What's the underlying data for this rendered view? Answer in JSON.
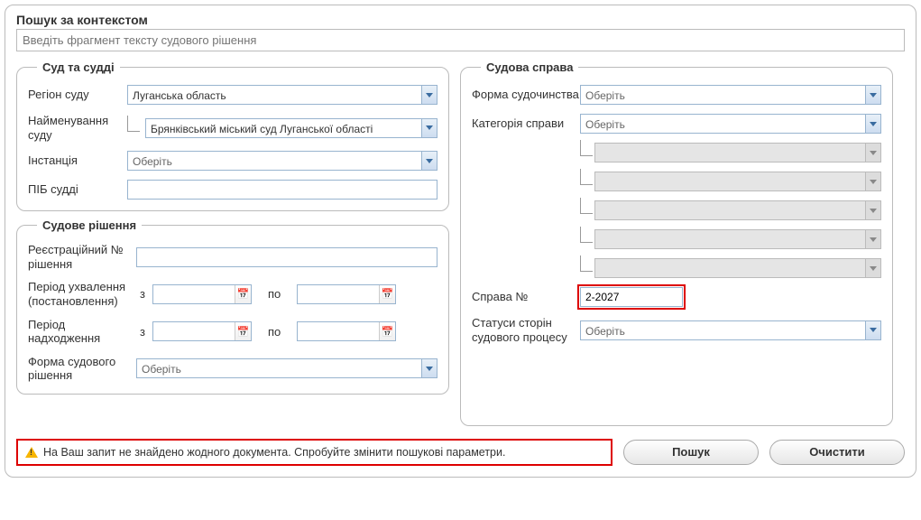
{
  "context": {
    "title": "Пошук за контекстом",
    "placeholder": "Введіть фрагмент тексту судового рішення"
  },
  "court_judges": {
    "legend": "Суд та судді",
    "region_label": "Регіон суду",
    "region_value": "Луганська область",
    "court_name_label": "Найменування суду",
    "court_name_value": "Брянківський міський суд Луганської області",
    "instance_label": "Інстанція",
    "instance_placeholder": "Оберіть",
    "judge_label": "ПІБ судді",
    "judge_value": ""
  },
  "decision": {
    "legend": "Судове рішення",
    "reg_no_label": "Реєстраційний № рішення",
    "reg_no_value": "",
    "adopt_period_label": "Період ухвалення (постановлення)",
    "receipt_period_label": "Період надходження",
    "from": "з",
    "to": "по",
    "form_label": "Форма судового рішення",
    "form_placeholder": "Оберіть"
  },
  "case": {
    "legend": "Судова справа",
    "proc_form_label": "Форма судочинства",
    "proc_form_placeholder": "Оберіть",
    "category_label": "Категорія справи",
    "category_placeholder": "Оберіть",
    "case_no_label": "Справа №",
    "case_no_value": "2-2027",
    "status_label": "Статуси сторін судового процесу",
    "status_placeholder": "Оберіть"
  },
  "footer": {
    "error": "На Ваш запит не знайдено жодного документа. Спробуйте змінити пошукові параметри.",
    "search": "Пошук",
    "clear": "Очистити"
  }
}
